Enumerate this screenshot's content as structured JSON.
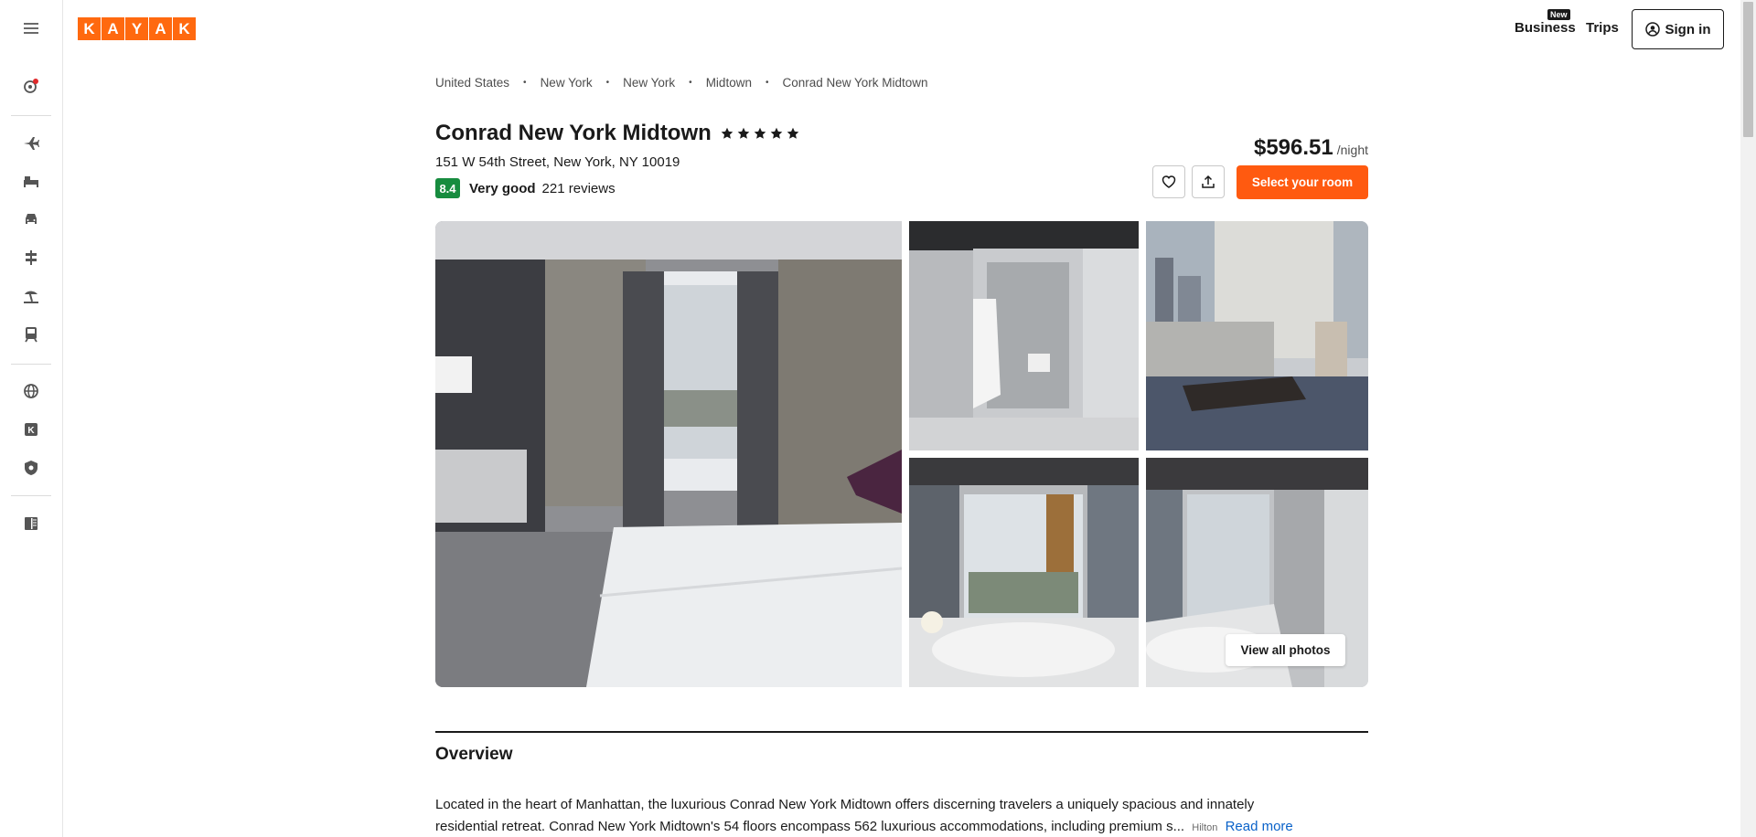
{
  "brand": {
    "letters": [
      "K",
      "A",
      "Y",
      "A",
      "K"
    ],
    "color": "#ff690f"
  },
  "rail": {
    "items": [
      {
        "name": "menu-icon"
      },
      {
        "name": "trip-alerts-icon"
      },
      {
        "name": "flights-icon"
      },
      {
        "name": "stays-icon"
      },
      {
        "name": "cars-icon"
      },
      {
        "name": "packages-icon"
      },
      {
        "name": "vacation-icon"
      },
      {
        "name": "trains-icon"
      },
      {
        "name": "explore-icon"
      },
      {
        "name": "kayak-business-icon"
      },
      {
        "name": "trust-icon"
      },
      {
        "name": "guide-icon"
      }
    ]
  },
  "header": {
    "business_label": "Business",
    "new_badge": "New",
    "trips_label": "Trips",
    "signin_label": "Sign in"
  },
  "breadcrumb": [
    "United States",
    "New York",
    "New York",
    "Midtown",
    "Conrad New York Midtown"
  ],
  "hotel": {
    "name": "Conrad New York Midtown",
    "stars": 5,
    "address": "151 W 54th Street, New York, NY 10019",
    "score": "8.4",
    "score_color": "#178c3f",
    "rating_word": "Very good",
    "reviews": "221 reviews"
  },
  "pricing": {
    "amount": "$596.51",
    "per": "/night",
    "select_label": "Select your room",
    "accent": "#ff5a10"
  },
  "gallery": {
    "view_all_label": "View all photos"
  },
  "overview": {
    "title": "Overview",
    "line1": "Located in the heart of Manhattan, the luxurious Conrad New York Midtown offers discerning travelers a uniquely spacious and innately",
    "line2": "residential retreat. Conrad New York Midtown's 54 floors encompass 562 luxurious accommodations, including premium s...",
    "source": "Hilton",
    "read_more": "Read more"
  }
}
